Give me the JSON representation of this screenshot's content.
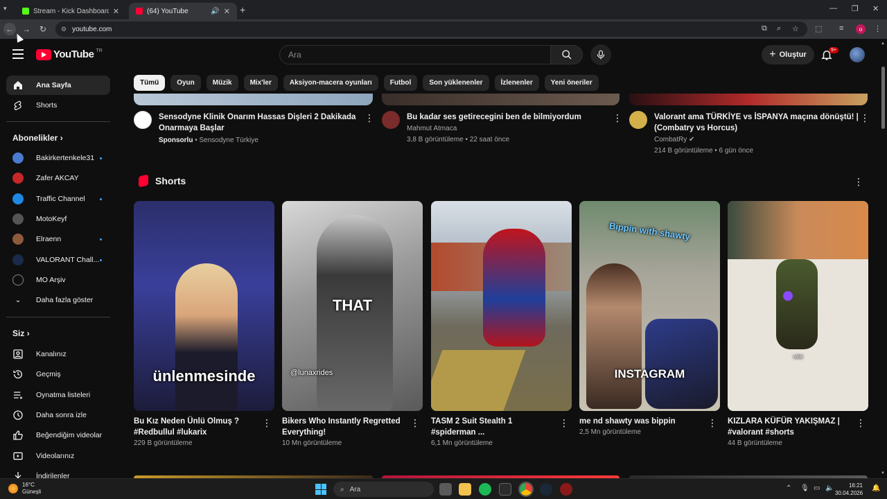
{
  "browser": {
    "tabs": [
      {
        "title": "Stream - Kick Dashboard",
        "favicon_color": "#53fc18"
      },
      {
        "title": "(64) YouTube",
        "favicon_color": "#ff0033"
      }
    ],
    "new_tab": "+",
    "url": "youtube.com"
  },
  "header": {
    "logo_text": "YouTube",
    "country_code": "TR",
    "search_placeholder": "Ara",
    "create_label": "Oluştur",
    "notif_badge": "9+"
  },
  "sidebar": {
    "main": [
      {
        "label": "Ana Sayfa",
        "icon": "home-icon"
      },
      {
        "label": "Shorts",
        "icon": "shorts-icon"
      }
    ],
    "subs_header": "Abonelikler",
    "subs": [
      {
        "label": "Bakirkertenkele31",
        "color": "#4a7bd0",
        "live": true
      },
      {
        "label": "Zafer AKCAY",
        "color": "#c62828",
        "live": false
      },
      {
        "label": "Traffic Channel",
        "color": "#1e88e5",
        "live": true
      },
      {
        "label": "MotoKeyf",
        "color": "#555555",
        "live": false
      },
      {
        "label": "Elraenn",
        "color": "#8d5a3b",
        "live": true
      },
      {
        "label": "VALORANT Chall...",
        "color": "#1a2a4a",
        "live": true
      },
      {
        "label": "MO Arşiv",
        "color": "#0f0f0f",
        "live": false
      },
      {
        "label": "Daha fazla göster",
        "icon": "chevron-down-icon"
      }
    ],
    "you_header": "Siz",
    "you": [
      {
        "label": "Kanalınız",
        "icon": "channel-icon"
      },
      {
        "label": "Geçmiş",
        "icon": "history-icon"
      },
      {
        "label": "Oynatma listeleri",
        "icon": "playlist-icon"
      },
      {
        "label": "Daha sonra izle",
        "icon": "watch-later-icon"
      },
      {
        "label": "Beğendiğim videolar",
        "icon": "like-icon"
      },
      {
        "label": "Videolarınız",
        "icon": "video-icon"
      },
      {
        "label": "İndirilenler",
        "icon": "download-icon"
      }
    ]
  },
  "chips": [
    "Tümü",
    "Oyun",
    "Müzik",
    "Mix'ler",
    "Aksiyon-macera oyunları",
    "Futbol",
    "Son yüklenenler",
    "İzlenenler",
    "Yeni öneriler"
  ],
  "top_videos": [
    {
      "title": "Sensodyne Klinik Onarım Hassas Dişleri 2 Dakikada Onarmaya Başlar",
      "meta1": "",
      "sponsored": "Sponsorlu",
      "channel": "Sensodyne Türkiye",
      "avatar_color": "#ffffff"
    },
    {
      "title": "Bu kadar ses getirecegini ben de bilmiyordum",
      "meta1": "Mahmut Atmaca",
      "meta2": "3,8 B görüntüleme • 22 saat önce",
      "avatar_color": "#7a2b2b"
    },
    {
      "title": "Valorant ama TÜRKİYE vs İSPANYA maçına dönüştü! | (Combatry vs Horcus)",
      "meta1": "CombatRy",
      "meta2": "214 B görüntüleme • 6 gün önce",
      "avatar_color": "#d4b04a"
    }
  ],
  "shorts": {
    "title": "Shorts",
    "items": [
      {
        "title": "Bu Kız Neden Ünlü Olmuş ? #Redbullul #lukarix",
        "views": "229 B görüntüleme",
        "overlay": "ünlenmesinde"
      },
      {
        "title": "Bikers Who Instantly Regretted Everything!",
        "views": "10 Mn görüntüleme",
        "overlay": "THAT",
        "overlay2": "@lunaxrides"
      },
      {
        "title": "TASM 2 Suit Stealth 1 #spiderman ...",
        "views": "6,1 Mn görüntüleme",
        "overlay": ""
      },
      {
        "title": "me nd shawty was bippin",
        "views": "2,5 Mn görüntüleme",
        "overlay": "INSTAGRAM",
        "overlay_top": "Bippin with shawty"
      },
      {
        "title": "KIZLARA KÜFÜR YAKIŞMAZ | #valorant #shorts",
        "views": "44 B görüntüleme",
        "overlay": "rafal"
      }
    ]
  },
  "taskbar": {
    "temp": "16°C",
    "weather": "Güneşli",
    "search": "Ara",
    "time": "16:21",
    "date": "30.04.2026"
  }
}
